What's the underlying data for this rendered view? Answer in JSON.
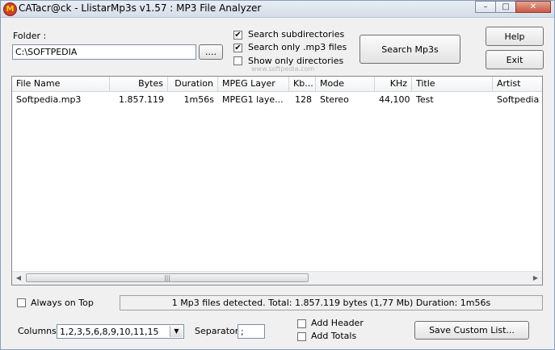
{
  "window": {
    "title": "CATacr@ck - LlistarMp3s v1.57 : MP3 File Analyzer",
    "min": "–",
    "max": "□",
    "close": "✕"
  },
  "folder": {
    "label": "Folder :",
    "value": "C:\\SOFTPEDIA",
    "browse_label": "...."
  },
  "options": {
    "search_subdirs": {
      "label": "Search subdirectories",
      "checked": true
    },
    "search_mp3": {
      "label": "Search only .mp3 files",
      "checked": true
    },
    "show_dirs": {
      "label": "Show only directories",
      "checked": false
    }
  },
  "buttons": {
    "search": "Search Mp3s",
    "help": "Help",
    "exit": "Exit",
    "save_custom": "Save Custom List..."
  },
  "watermark": "www.softpedia.com",
  "table": {
    "headers": [
      "File Name",
      "Bytes",
      "Duration",
      "MPEG Layer",
      "Kb...",
      "Mode",
      "KHz",
      "Title",
      "Artist"
    ],
    "rows": [
      [
        "Softpedia.mp3",
        "1.857.119",
        "1m56s",
        "MPEG1 laye...",
        "128",
        "Stereo",
        "44,100",
        "Test",
        "Softpedia"
      ]
    ]
  },
  "always_on_top": {
    "label": "Always on Top",
    "checked": false
  },
  "status": "1 Mp3 files detected. Total: 1.857.119 bytes (1,77 Mb)  Duration: 1m56s",
  "columns": {
    "label": "Columns:",
    "value": "1,2,3,5,6,8,9,10,11,15"
  },
  "separator": {
    "label": "Separator:",
    "value": ";"
  },
  "add_header": {
    "label": "Add Header",
    "checked": false
  },
  "add_totals": {
    "label": "Add Totals",
    "checked": false
  }
}
